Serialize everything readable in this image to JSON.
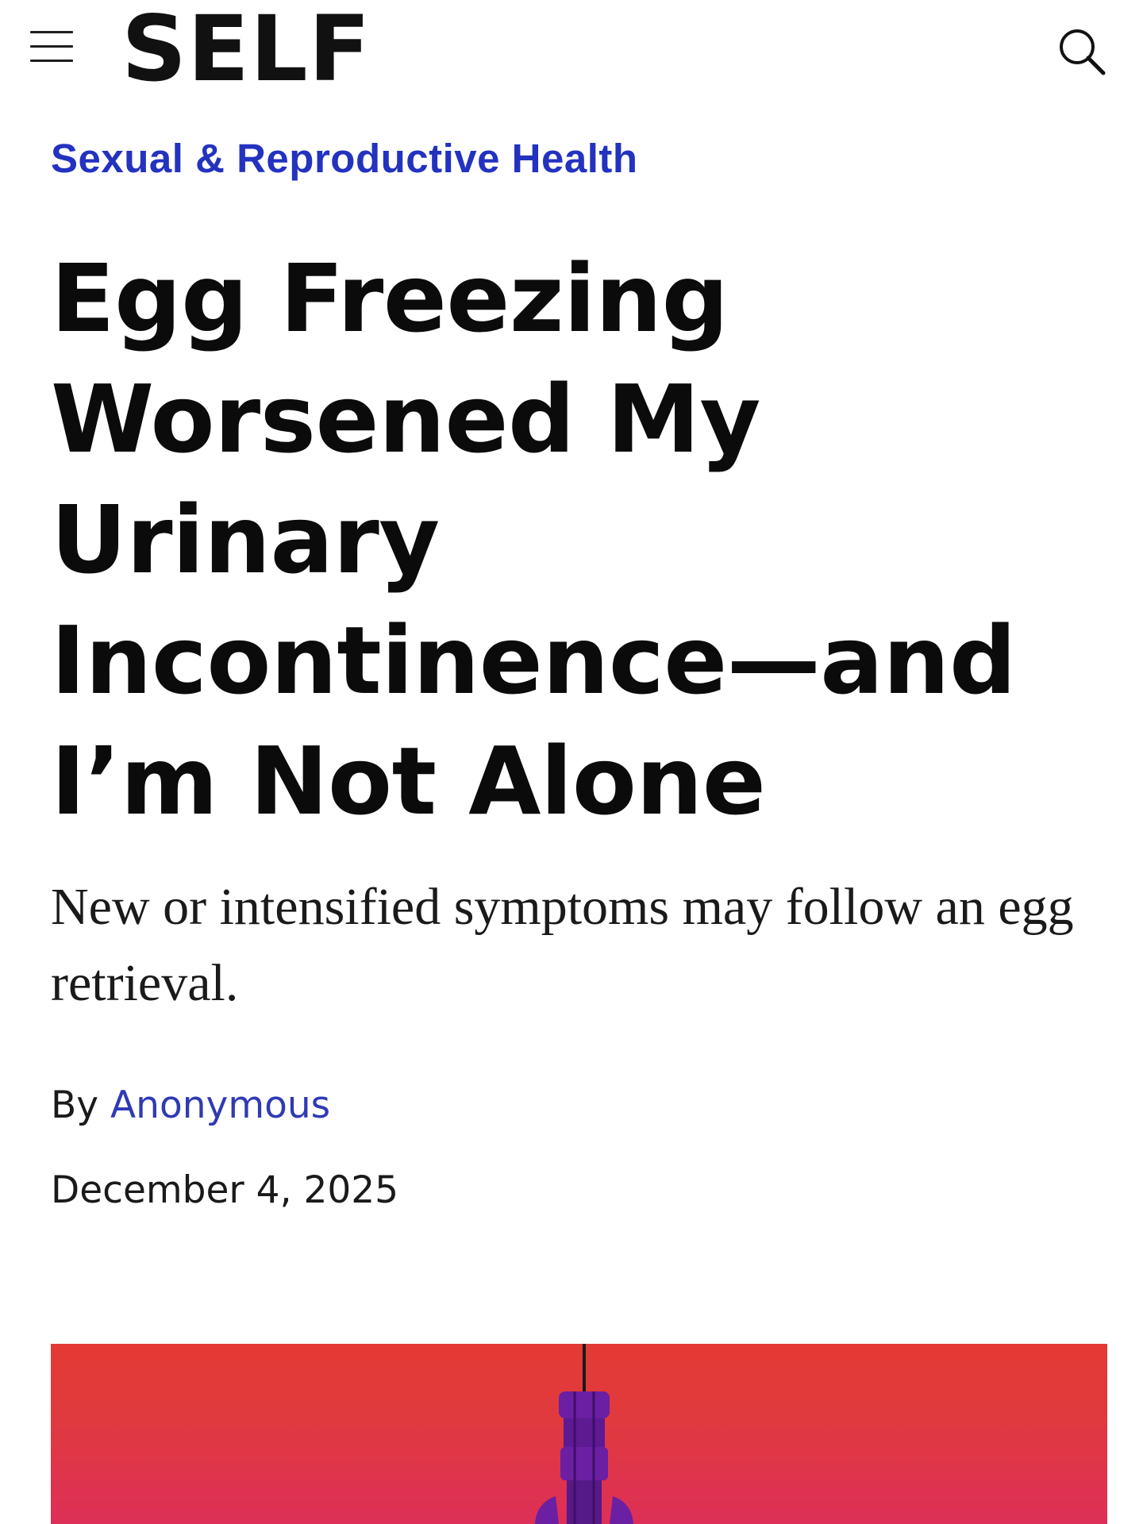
{
  "header": {
    "menu_icon": "hamburger-menu-icon",
    "logo": "SELF",
    "search_icon": "search-icon"
  },
  "article": {
    "category": "Sexual & Reproductive Health",
    "headline_lines": [
      "Egg Freezing",
      "Worsened My",
      "Urinary",
      "Incontinence—and",
      "I’m Not Alone"
    ],
    "dek": "New or intensified symptoms may follow an egg retrieval.",
    "byline_prefix": "By",
    "author": "Anonymous",
    "date": "December 4, 2025"
  },
  "hero_image": {
    "description_icon": "pendant-lamp-illustration",
    "background_top": "#e33a34",
    "background_bottom": "#dd2f57",
    "object_color": "#6b1fa3"
  },
  "colors": {
    "link_blue": "#2332bf",
    "text": "#111111"
  }
}
